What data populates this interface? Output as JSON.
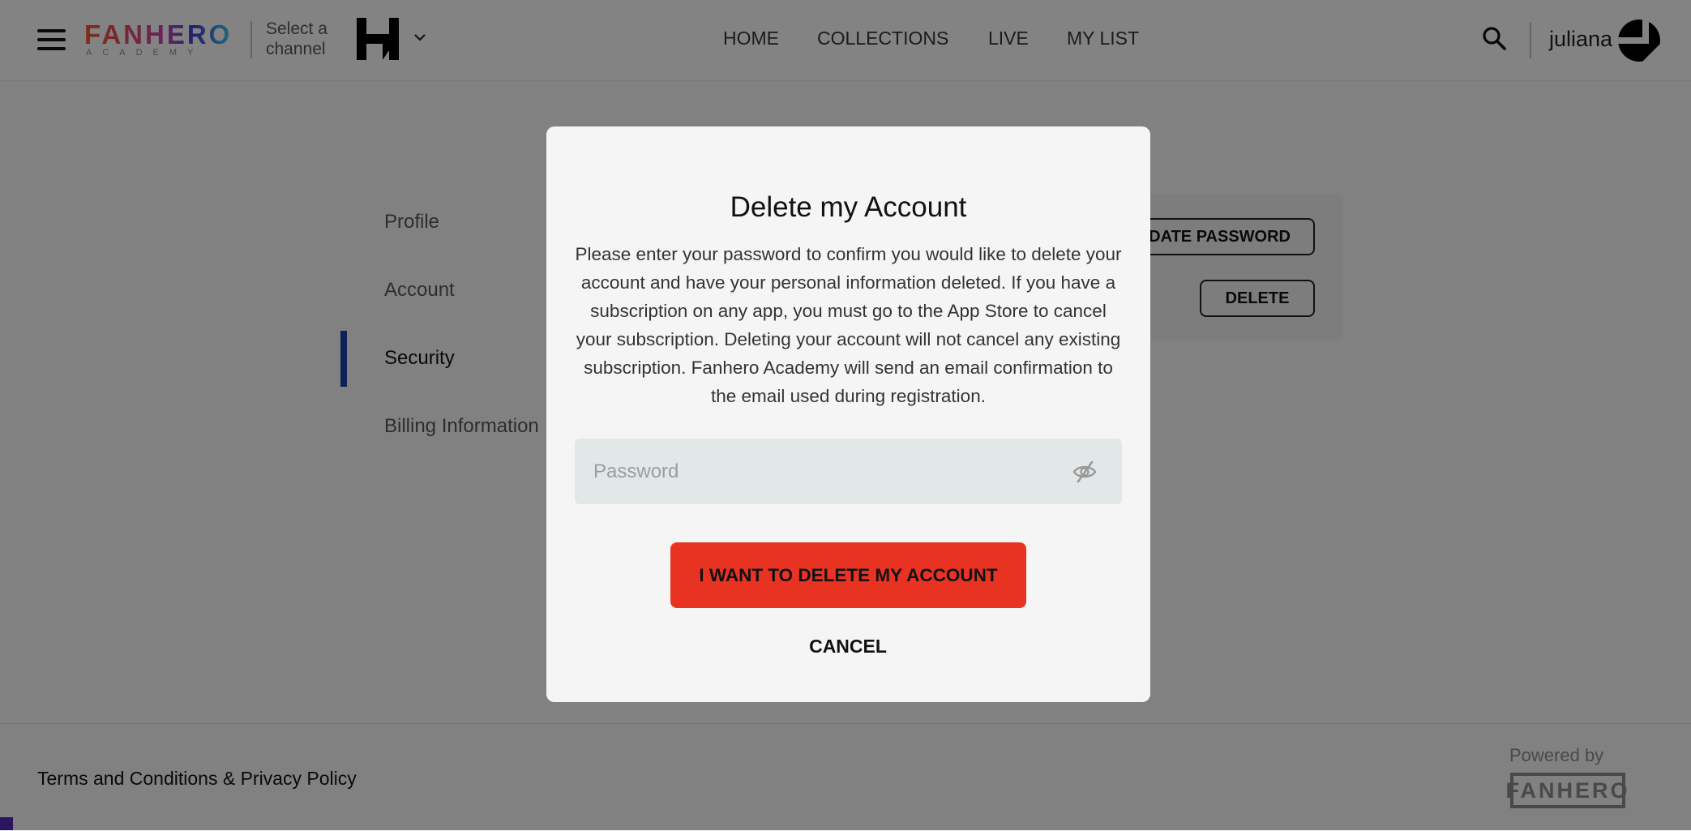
{
  "header": {
    "logo": {
      "name": "FANHERO",
      "subtitle": "ACADEMY",
      "gradient": [
        "#e8562e",
        "#e24876",
        "#c43fb0",
        "#3b3fd0",
        "#46c1e8"
      ]
    },
    "channel_selector": {
      "label_line1": "Select a",
      "label_line2": "channel",
      "icon": "channel-logo-icon"
    },
    "nav": [
      {
        "label": "HOME"
      },
      {
        "label": "COLLECTIONS"
      },
      {
        "label": "LIVE"
      },
      {
        "label": "MY LIST"
      }
    ],
    "user": {
      "name": "juliana"
    }
  },
  "sidebar": {
    "items": [
      {
        "label": "Profile",
        "active": false
      },
      {
        "label": "Account",
        "active": false
      },
      {
        "label": "Security",
        "active": true
      },
      {
        "label": "Billing Information",
        "active": false
      }
    ],
    "active_color": "#1b3ea6"
  },
  "security": {
    "update_password_label": "UPDATE PASSWORD",
    "delete_label": "DELETE"
  },
  "modal": {
    "title": "Delete my Account",
    "body": "Please enter your password to confirm you would like to delete your account and have your personal information deleted. If you have a subscription on any app, you must go to the App Store to cancel your subscription. Deleting your account will not cancel any existing subscription. Fanhero Academy will send an email confirmation to the email used during registration.",
    "password": {
      "placeholder": "Password",
      "value": ""
    },
    "confirm_label": "I WANT TO DELETE MY ACCOUNT",
    "confirm_color": "#e83323",
    "cancel_label": "CANCEL"
  },
  "footer": {
    "terms_link": "Terms and Conditions & Privacy Policy",
    "powered_by": "Powered by",
    "powered_logo": "FANHERO"
  }
}
